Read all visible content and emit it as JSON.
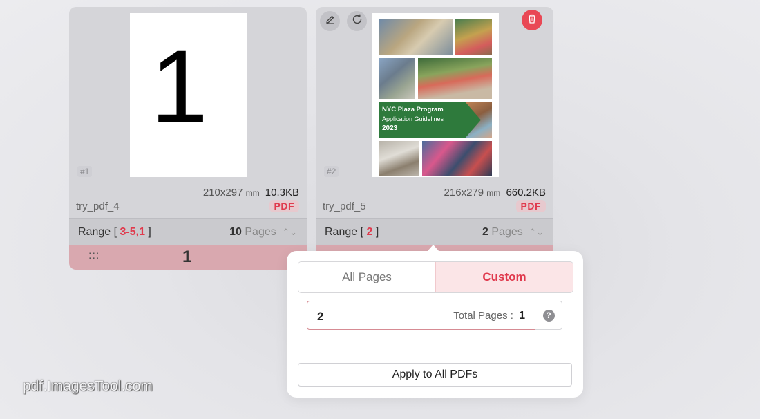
{
  "cards": [
    {
      "page_tag": "#1",
      "thumb_text": "1",
      "dims": "210x297",
      "dims_unit": "mm",
      "size": "10.3KB",
      "filename": "try_pdf_4",
      "badge": "PDF",
      "range_prefix": "Range [",
      "range_value": "3-5,1",
      "range_suffix": "]",
      "pages_num": "10",
      "pages_label": "Pages",
      "order_handle": ":::",
      "order_num": "1"
    },
    {
      "page_tag": "#2",
      "dims": "216x279",
      "dims_unit": "mm",
      "size": "660.2KB",
      "filename": "try_pdf_5",
      "badge": "PDF",
      "range_prefix": "Range [",
      "range_value": "2",
      "range_suffix": "]",
      "pages_num": "2",
      "pages_label": "Pages",
      "cover": {
        "banner_title": "NYC Plaza Program",
        "banner_sub": "Application Guidelines",
        "banner_year": "2023"
      }
    }
  ],
  "popover": {
    "tab_all": "All Pages",
    "tab_custom": "Custom",
    "range_value": "2",
    "total_label": "Total Pages :",
    "total_value": "1",
    "help": "?",
    "apply_label": "Apply to All PDFs"
  },
  "watermark": "pdf.ImagesTool.com",
  "colors": {
    "accent": "#e03a4d",
    "card_bg": "#d5d5d9",
    "order_bar": "#d9a8af",
    "custom_tab_bg": "#fbe5e7",
    "trash": "#e94855"
  },
  "icons": [
    "edit-icon",
    "rotate-icon",
    "trash-icon",
    "chevron-updown-icon",
    "help-icon"
  ]
}
